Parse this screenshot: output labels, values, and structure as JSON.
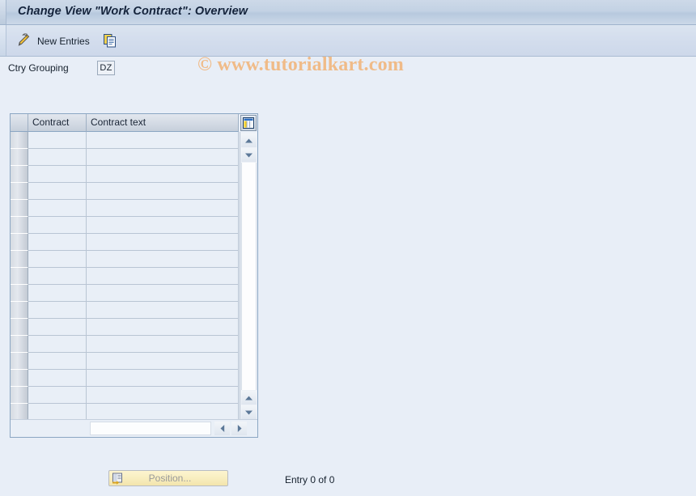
{
  "window": {
    "title": "Change View \"Work Contract\": Overview"
  },
  "toolbar": {
    "new_entries_label": "New Entries",
    "new_entries_icon": "pencil-icon",
    "copy_icon": "copy-documents-icon"
  },
  "watermark": {
    "text": "© www.tutorialkart.com",
    "color": "#f0bb88"
  },
  "selection": {
    "ctry_grouping_label": "Ctry Grouping",
    "ctry_grouping_value": "DZ"
  },
  "table": {
    "columns": [
      {
        "key": "select",
        "label": ""
      },
      {
        "key": "contract",
        "label": "Contract"
      },
      {
        "key": "contract_text",
        "label": "Contract text"
      }
    ],
    "config_icon": "table-settings-icon",
    "row_count": 17,
    "rows": [],
    "vscroll": {
      "up_icon": "scroll-up-icon",
      "down_icon": "scroll-down-icon",
      "page_up_icon": "scroll-up-icon",
      "page_down_icon": "scroll-down-icon"
    },
    "hscroll": {
      "left_icon": "scroll-left-icon",
      "right_icon": "scroll-right-icon"
    }
  },
  "footer": {
    "position_button_label": "Position...",
    "position_button_icon": "position-icon",
    "position_button_enabled": false,
    "entry_status": "Entry 0 of 0"
  },
  "colors": {
    "background": "#e8eef7",
    "title_bar": "#c3d2e4",
    "table_border": "#8ba6c3",
    "button_yellow": "#f8eec0"
  }
}
